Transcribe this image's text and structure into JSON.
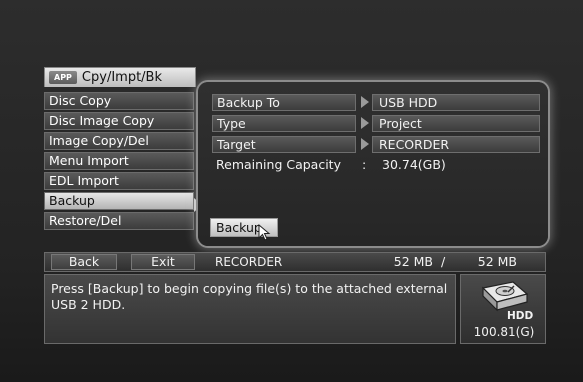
{
  "app": {
    "badge": "APP",
    "title": "Cpy/Impt/Bk"
  },
  "menu": {
    "items": [
      {
        "label": "Disc Copy"
      },
      {
        "label": "Disc Image Copy"
      },
      {
        "label": "Image Copy/Del"
      },
      {
        "label": "Menu Import"
      },
      {
        "label": "EDL Import"
      },
      {
        "label": "Backup",
        "selected": true
      },
      {
        "label": "Restore/Del"
      }
    ]
  },
  "settings": {
    "backup_to": {
      "label": "Backup To",
      "value": "USB HDD"
    },
    "type": {
      "label": "Type",
      "value": "Project"
    },
    "target": {
      "label": "Target",
      "value": "RECORDER"
    },
    "remaining": {
      "label": "Remaining Capacity",
      "colon": ":",
      "value": "30.74(GB)"
    },
    "backup_button": "Backup"
  },
  "statusbar": {
    "back": "Back",
    "exit": "Exit",
    "target": "RECORDER",
    "used": "52 MB",
    "sep": "/",
    "total": "52 MB"
  },
  "message": "Press [Backup] to begin copying file(s) to the attached external USB 2 HDD.",
  "hdd": {
    "label": "HDD",
    "capacity": "100.81(G)"
  },
  "colors": {
    "accent_glow": "#c8c8c8",
    "panel_bg": "#2b2b2b"
  }
}
